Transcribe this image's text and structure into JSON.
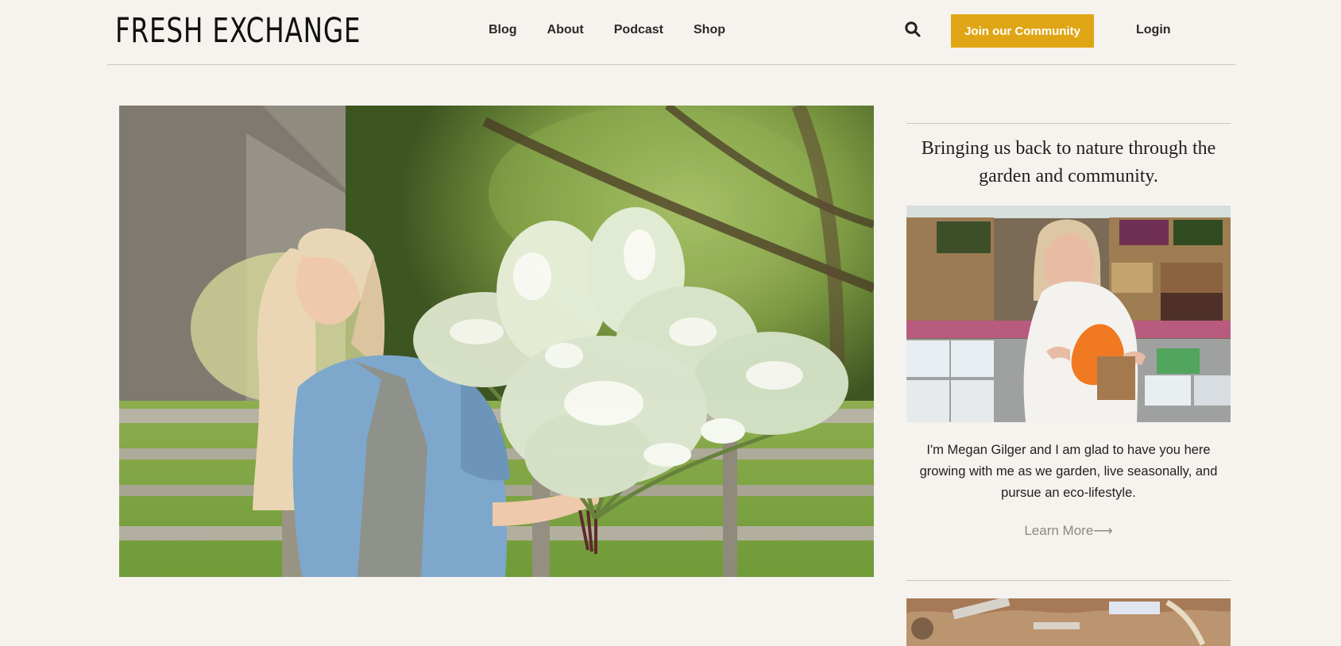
{
  "header": {
    "logo_text": "FRESH EXCHANGE",
    "nav": [
      "Blog",
      "About",
      "Podcast",
      "Shop"
    ],
    "search_icon": "search-icon",
    "join_label": "Join our Community",
    "login_label": "Login"
  },
  "sidebar": {
    "tagline": "Bringing us back to nature through the garden and community.",
    "bio": "I'm Megan Gilger and I am glad to have you here growing with me as we garden, live seasonally, and pursue an eco-lifestyle.",
    "learn_more": "Learn More⟶"
  },
  "colors": {
    "background": "#f6f3ee",
    "accent": "#dfa515",
    "text": "#1f1f1f",
    "muted": "#8d8781",
    "rule": "#cdc8c0"
  }
}
